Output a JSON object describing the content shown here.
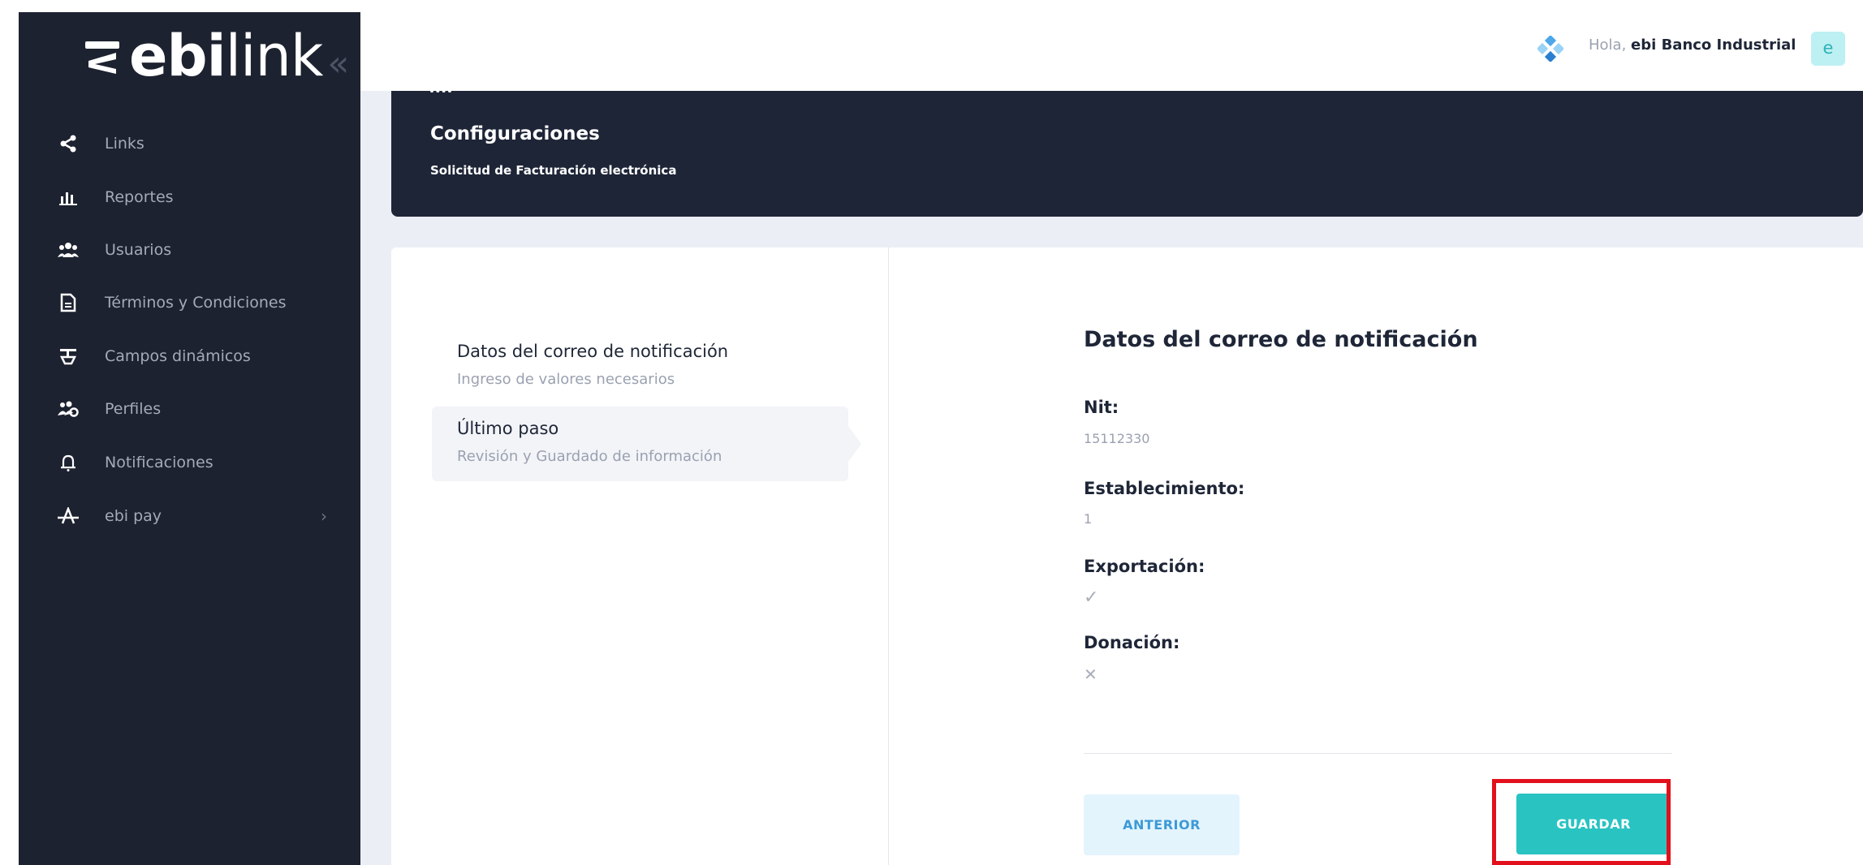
{
  "app": {
    "logo_bold": "ebi",
    "logo_light": "link",
    "collapse_glyph": "«"
  },
  "sidebar": {
    "items": [
      {
        "label": "Links",
        "icon": "share-icon"
      },
      {
        "label": "Reportes",
        "icon": "bar-chart-icon"
      },
      {
        "label": "Usuarios",
        "icon": "users-icon"
      },
      {
        "label": "Términos y Condiciones",
        "icon": "document-icon"
      },
      {
        "label": "Campos dinámicos",
        "icon": "fields-icon"
      },
      {
        "label": "Perfiles",
        "icon": "profiles-icon"
      },
      {
        "label": "Notificaciones",
        "icon": "bell-icon"
      },
      {
        "label": "ebi pay",
        "icon": "ebi-pay-icon",
        "arrow": "›"
      }
    ]
  },
  "header": {
    "greeting": "Hola,",
    "user_name": "ebi Banco Industrial",
    "avatar_letter": "e"
  },
  "banner": {
    "title": "Configuraciones",
    "subtitle": "Solicitud de Facturación electrónica"
  },
  "steps": [
    {
      "title": "Datos del correo de notificación",
      "subtitle": "Ingreso de valores necesarios"
    },
    {
      "title": "Último paso",
      "subtitle": "Revisión y Guardado de información"
    }
  ],
  "details": {
    "title": "Datos del correo de notificación",
    "nit_label": "Nit:",
    "nit_value": "15112330",
    "establecimiento_label": "Establecimiento:",
    "establecimiento_value": "1",
    "exportacion_label": "Exportación:",
    "exportacion_value": "✓",
    "donacion_label": "Donación:",
    "donacion_value": "✕"
  },
  "buttons": {
    "previous": "ANTERIOR",
    "save": "GUARDAR"
  },
  "colors": {
    "sidebar_bg": "#1d2230",
    "banner_bg": "#1e2537",
    "accent": "#29c3c2",
    "highlight": "#e2101d"
  }
}
